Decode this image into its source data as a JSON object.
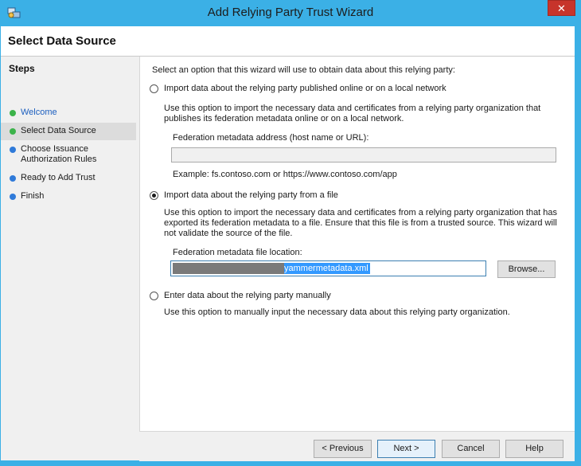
{
  "window": {
    "title": "Add Relying Party Trust Wizard",
    "close_glyph": "✕"
  },
  "page_title": "Select Data Source",
  "steps": {
    "title": "Steps",
    "items": [
      {
        "label": "Welcome",
        "dot_color": "#3cb34a"
      },
      {
        "label": "Select Data Source",
        "dot_color": "#3cb34a"
      },
      {
        "label_line1": "Choose Issuance",
        "label_line2": "Authorization Rules",
        "dot_color": "#2f7ad9"
      },
      {
        "label": "Ready to Add Trust",
        "dot_color": "#2f7ad9"
      },
      {
        "label": "Finish",
        "dot_color": "#2f7ad9"
      }
    ]
  },
  "main": {
    "intro": "Select an option that this wizard will use to obtain data about this relying party:",
    "option_online": {
      "label": "Import data about the relying party published online or on a local network",
      "desc_line1": "Use this option to import the necessary data and certificates from a relying party organization that",
      "desc_line2": "publishes its federation metadata online or on a local network.",
      "field_label": "Federation metadata address (host name or URL):",
      "field_value": "",
      "example": "Example: fs.contoso.com or https://www.contoso.com/app"
    },
    "option_file": {
      "label": "Import data about the relying party from a file",
      "desc_line1": "Use this option to import the necessary data and certificates from a relying party organization that has",
      "desc_line2": "exported its federation metadata to a file. Ensure that this file is from a trusted source.  This wizard will",
      "desc_line3": "not validate the source of the file.",
      "field_label": "Federation metadata file location:",
      "field_value": "yammermetadata.xml",
      "browse_label": "Browse..."
    },
    "option_manual": {
      "label": "Enter data about the relying party manually",
      "desc": "Use this option to manually input the necessary data about this relying party organization."
    },
    "selected_option": "file"
  },
  "footer": {
    "previous_label": "< Previous",
    "next_label": "Next >",
    "cancel_label": "Cancel",
    "help_label": "Help"
  }
}
